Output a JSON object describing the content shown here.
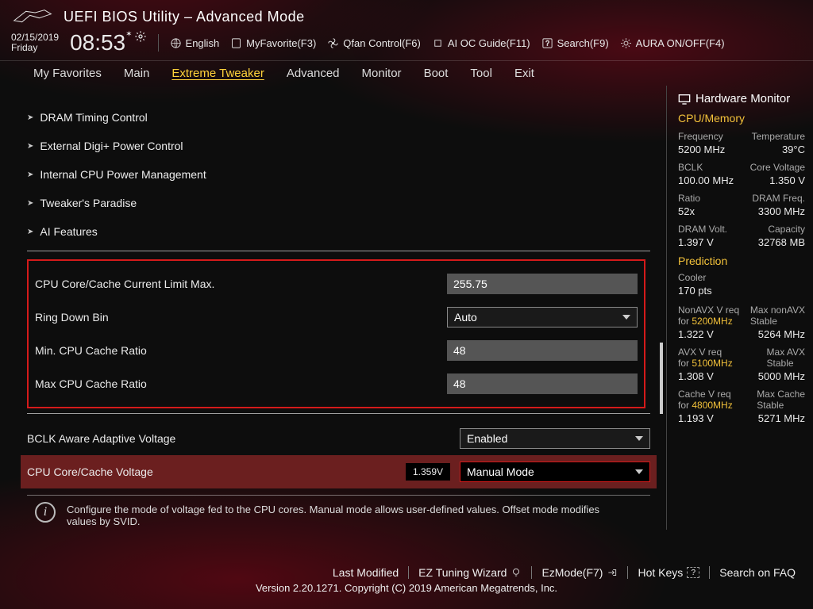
{
  "header": {
    "title": "UEFI BIOS Utility – Advanced Mode",
    "date": "02/15/2019",
    "day": "Friday",
    "time": "08:53",
    "toolbar": {
      "language": "English",
      "favorite": "MyFavorite(F3)",
      "qfan": "Qfan Control(F6)",
      "aioc": "AI OC Guide(F11)",
      "search": "Search(F9)",
      "aura": "AURA ON/OFF(F4)"
    }
  },
  "tabs": [
    "My Favorites",
    "Main",
    "Extreme Tweaker",
    "Advanced",
    "Monitor",
    "Boot",
    "Tool",
    "Exit"
  ],
  "active_tab": "Extreme Tweaker",
  "submenus": [
    "DRAM Timing Control",
    "External Digi+ Power Control",
    "Internal CPU Power Management",
    "Tweaker's Paradise",
    "AI Features"
  ],
  "settings": {
    "boxed": [
      {
        "label": "CPU Core/Cache Current Limit Max.",
        "type": "text",
        "value": "255.75"
      },
      {
        "label": "Ring Down Bin",
        "type": "dd",
        "value": "Auto"
      },
      {
        "label": "Min. CPU Cache Ratio",
        "type": "text",
        "value": "48"
      },
      {
        "label": "Max CPU Cache Ratio",
        "type": "text",
        "value": "48"
      }
    ],
    "below": [
      {
        "label": "BCLK Aware Adaptive Voltage",
        "type": "dd",
        "value": "Enabled"
      },
      {
        "label": "CPU Core/Cache Voltage",
        "type": "dd",
        "value": "Manual Mode",
        "live": "1.359V",
        "selected": true
      }
    ]
  },
  "help": "Configure the mode of voltage fed to the CPU cores. Manual mode allows user-defined values. Offset mode modifies values by SVID.",
  "hwmon": {
    "title": "Hardware Monitor",
    "sections": [
      {
        "name": "CPU/Memory",
        "pairs": [
          [
            "Frequency",
            "5200 MHz",
            "Temperature",
            "39°C"
          ],
          [
            "BCLK",
            "100.00 MHz",
            "Core Voltage",
            "1.350 V"
          ],
          [
            "Ratio",
            "52x",
            "DRAM Freq.",
            "3300 MHz"
          ],
          [
            "DRAM Volt.",
            "1.397 V",
            "Capacity",
            "32768 MB"
          ]
        ]
      },
      {
        "name": "Prediction",
        "pairs": [
          [
            "Cooler",
            "170 pts",
            "",
            ""
          ],
          [
            "NonAVX V req for 5200MHz",
            "1.322 V",
            "Max nonAVX Stable",
            "5264 MHz"
          ],
          [
            "AVX V req for 5100MHz",
            "1.308 V",
            "Max AVX Stable",
            "5000 MHz"
          ],
          [
            "Cache V req for 4800MHz",
            "1.193 V",
            "Max Cache Stable",
            "5271 MHz"
          ]
        ]
      }
    ]
  },
  "footer": {
    "links": [
      "Last Modified",
      "EZ Tuning Wizard",
      "EzMode(F7)",
      "Hot Keys",
      "Search on FAQ"
    ],
    "copyright": "Version 2.20.1271. Copyright (C) 2019 American Megatrends, Inc."
  }
}
